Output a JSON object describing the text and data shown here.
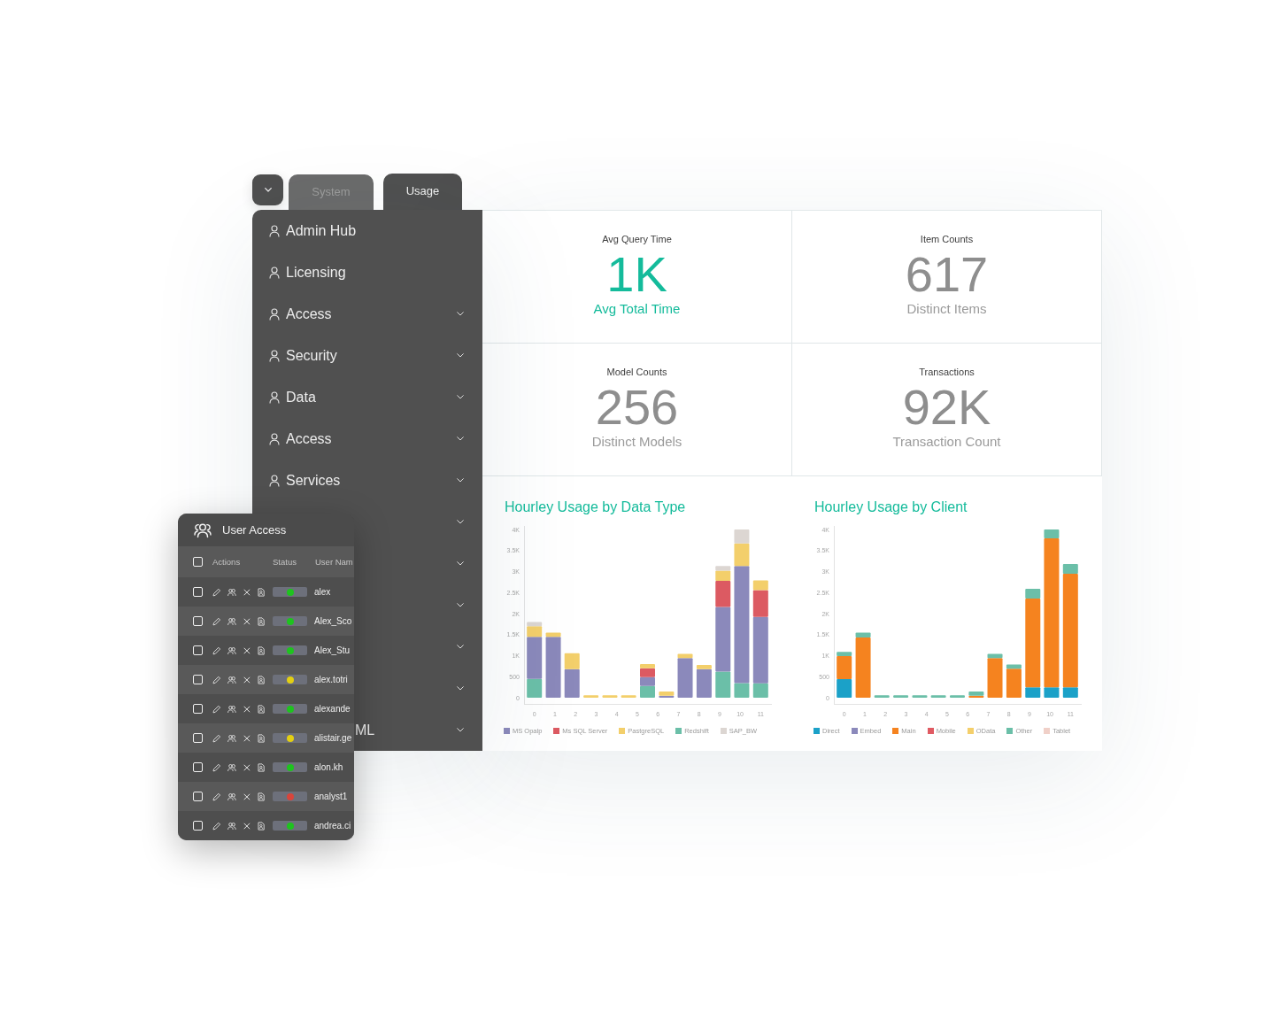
{
  "tab_bar": {
    "tabs": [
      {
        "label": "System",
        "selected": false
      },
      {
        "label": "Usage",
        "selected": true
      }
    ]
  },
  "sidebar": {
    "items": [
      {
        "label": "Admin Hub",
        "expandable": false,
        "covered": false
      },
      {
        "label": "Licensing",
        "expandable": false,
        "covered": false
      },
      {
        "label": "Access",
        "expandable": true,
        "covered": false
      },
      {
        "label": "Security",
        "expandable": true,
        "covered": false
      },
      {
        "label": "Data",
        "expandable": true,
        "covered": false
      },
      {
        "label": "Access",
        "expandable": true,
        "covered": false
      },
      {
        "label": "Services",
        "expandable": true,
        "covered": false
      },
      {
        "expandable": true,
        "covered": true
      },
      {
        "expandable": true,
        "covered": true
      },
      {
        "expandable": true,
        "covered": true
      },
      {
        "expandable": true,
        "covered": true
      },
      {
        "expandable": true,
        "covered": true
      },
      {
        "label": "ML",
        "expandable": true,
        "covered": true
      }
    ]
  },
  "kpis": [
    {
      "title": "Avg Query Time",
      "value": "1K",
      "caption": "Avg Total Time",
      "highlighted": true
    },
    {
      "title": "Item Counts",
      "value": "617",
      "caption": "Distinct Items",
      "highlighted": false
    },
    {
      "title": "Model Counts",
      "value": "256",
      "caption": "Distinct Models",
      "highlighted": false
    },
    {
      "title": "Transactions",
      "value": "92K",
      "caption": "Transaction Count",
      "highlighted": false
    }
  ],
  "charts": [
    {
      "chart_data": {
        "type": "bar",
        "title": "Hourley Usage by Data Type",
        "stacked": true,
        "legend": "bottom",
        "x": [
          0,
          0.92,
          1.83,
          2.75,
          3.67,
          4.58,
          5.5,
          6.42,
          7.33,
          8.25,
          9.17,
          10.08,
          11
        ],
        "xlim": [
          -0.46,
          11.46
        ],
        "ylim": [
          0,
          4000
        ],
        "xticks": [
          0,
          1,
          2,
          3,
          4,
          5,
          6,
          7,
          8,
          9,
          10,
          11
        ],
        "yticks": [
          {
            "value": 0,
            "label": "0"
          },
          {
            "value": 500,
            "label": "500"
          },
          {
            "value": 1000,
            "label": "1K"
          },
          {
            "value": 1500,
            "label": "1.5K"
          },
          {
            "value": 2000,
            "label": "2K"
          },
          {
            "value": 2500,
            "label": "2.5K"
          },
          {
            "value": 3000,
            "label": "3K"
          },
          {
            "value": 3500,
            "label": "3.5K"
          },
          {
            "value": 4000,
            "label": "4K"
          }
        ],
        "series": [
          {
            "name": "MS Opalp",
            "color": "#8b89bb",
            "values": [
              1000,
              1450,
              680,
              0,
              0,
              0,
              210,
              50,
              940,
              680,
              1540,
              2780,
              1580
            ]
          },
          {
            "name": "Ms SQL Server",
            "color": "#dc5a62",
            "values": [
              0,
              0,
              0,
              0,
              0,
              0,
              210,
              0,
              0,
              0,
              620,
              0,
              640
            ]
          },
          {
            "name": "PastgreSQL",
            "color": "#f3cf6b",
            "values": [
              250,
              100,
              380,
              60,
              60,
              60,
              100,
              100,
              100,
              100,
              240,
              540,
              230
            ]
          },
          {
            "name": "Redshift",
            "color": "#6bbfa8",
            "values": [
              450,
              0,
              0,
              0,
              0,
              0,
              280,
              0,
              0,
              0,
              620,
              350,
              340
            ]
          },
          {
            "name": "SAP_BW",
            "color": "#dcd6d2",
            "values": [
              100,
              0,
              0,
              0,
              0,
              0,
              0,
              0,
              0,
              0,
              110,
              330,
              0
            ]
          }
        ]
      }
    },
    {
      "chart_data": {
        "type": "bar",
        "title": "Hourley Usage by Client",
        "stacked": true,
        "legend": "bottom",
        "x": [
          0,
          0.92,
          1.83,
          2.75,
          3.67,
          4.58,
          5.5,
          6.42,
          7.33,
          8.25,
          9.17,
          10.08,
          11
        ],
        "xlim": [
          -0.46,
          11.46
        ],
        "ylim": [
          0,
          4000
        ],
        "xticks": [
          0,
          1,
          2,
          3,
          4,
          5,
          6,
          7,
          8,
          9,
          10,
          11
        ],
        "yticks": [
          {
            "value": 0,
            "label": "0"
          },
          {
            "value": 500,
            "label": "500"
          },
          {
            "value": 1000,
            "label": "1K"
          },
          {
            "value": 1500,
            "label": "1.5K"
          },
          {
            "value": 2000,
            "label": "2K"
          },
          {
            "value": 2500,
            "label": "2.5K"
          },
          {
            "value": 3000,
            "label": "3K"
          },
          {
            "value": 3500,
            "label": "3.5K"
          },
          {
            "value": 4000,
            "label": "4K"
          }
        ],
        "series": [
          {
            "name": "Direct",
            "color": "#1ba1c8",
            "values": [
              440,
              0,
              0,
              0,
              0,
              0,
              0,
              0,
              0,
              0,
              250,
              250,
              250
            ]
          },
          {
            "name": "Embed",
            "color": "#8b89bb",
            "values": [
              0,
              0,
              0,
              0,
              0,
              0,
              0,
              0,
              0,
              0,
              0,
              0,
              0
            ]
          },
          {
            "name": "Main",
            "color": "#f5831f",
            "values": [
              550,
              1430,
              0,
              0,
              0,
              0,
              0,
              50,
              940,
              690,
              2110,
              3540,
              2700
            ]
          },
          {
            "name": "Mobile",
            "color": "#e05a62",
            "values": [
              0,
              0,
              0,
              0,
              0,
              0,
              0,
              0,
              0,
              0,
              0,
              0,
              0
            ]
          },
          {
            "name": "OData",
            "color": "#f4cf6b",
            "values": [
              0,
              0,
              0,
              0,
              0,
              0,
              0,
              0,
              0,
              0,
              0,
              0,
              0
            ]
          },
          {
            "name": "Other",
            "color": "#6bbfa8",
            "values": [
              100,
              120,
              60,
              60,
              60,
              60,
              60,
              100,
              100,
              100,
              230,
              210,
              230
            ]
          },
          {
            "name": "Tablet",
            "color": "#f0d0c8",
            "values": [
              0,
              0,
              0,
              0,
              0,
              0,
              0,
              0,
              0,
              0,
              0,
              0,
              0
            ]
          }
        ]
      }
    }
  ],
  "user_access_panel": {
    "title": "User Access",
    "select_all_checked": false,
    "columns": [
      "Actions",
      "Status",
      "User Nam"
    ],
    "rows": [
      {
        "checked": false,
        "color": "#1ec31e",
        "user": "alex"
      },
      {
        "checked": false,
        "color": "#1ec31e",
        "user": "Alex_Sco"
      },
      {
        "checked": false,
        "color": "#1ec31e",
        "user": "Alex_Stu"
      },
      {
        "checked": false,
        "color": "#e3cf12",
        "user": "alex.totri"
      },
      {
        "checked": false,
        "color": "#1ec31e",
        "user": "alexande"
      },
      {
        "checked": false,
        "color": "#e3cf12",
        "user": "alistair.ge"
      },
      {
        "checked": false,
        "color": "#1ec31e",
        "user": "alon.kh"
      },
      {
        "checked": false,
        "color": "#d8453b",
        "user": "analyst1"
      },
      {
        "checked": false,
        "color": "#1ec31e",
        "user": "andrea.ci"
      }
    ]
  }
}
